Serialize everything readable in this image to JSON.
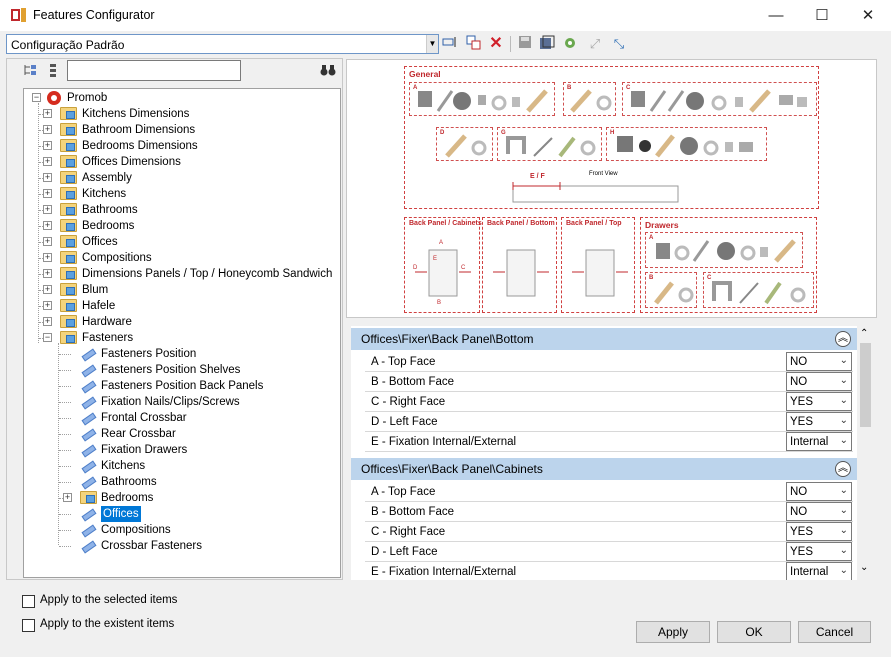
{
  "window": {
    "title": "Features Configurator",
    "minimize": "—",
    "maximize": "☐",
    "close": "✕"
  },
  "config": {
    "selected": "Configuração Padrão"
  },
  "tree": {
    "root": "Promob",
    "items": [
      "Kitchens Dimensions",
      "Bathroom Dimensions",
      "Bedrooms Dimensions",
      "Offices Dimensions",
      "Assembly",
      "Kitchens",
      "Bathrooms",
      "Bedrooms",
      "Offices",
      "Compositions",
      "Dimensions Panels / Top / Honeycomb Sandwich",
      "Blum",
      "Hafele",
      "Hardware",
      "Fasteners"
    ],
    "fasteners_children": [
      "Fasteners Position",
      "Fasteners Position Shelves",
      "Fasteners Position Back Panels",
      "Fixation Nails/Clips/Screws",
      "Frontal Crossbar",
      "Rear Crossbar",
      "Fixation Drawers",
      "Kitchens",
      "Bathrooms",
      "Bedrooms",
      "Offices",
      "Compositions",
      "Crossbar Fasteners"
    ],
    "selected_item": "Offices"
  },
  "checkboxes": {
    "apply_selected": "Apply to the selected items",
    "apply_existent": "Apply to the existent items"
  },
  "preview": {
    "general": "General",
    "front_view": "Front View",
    "dim_label": "E / F",
    "back_panel_cabinets": "Back Panel / Cabinets",
    "back_panel_bottom": "Back Panel / Bottom",
    "back_panel_top": "Back Panel / Top",
    "drawers": "Drawers",
    "group_letters": [
      "A",
      "B",
      "C",
      "D",
      "G",
      "H"
    ],
    "face_letters": [
      "A",
      "B",
      "C",
      "D",
      "E"
    ]
  },
  "sections": [
    {
      "title": "Offices\\Fixer\\Back Panel\\Bottom",
      "rows": [
        {
          "label": "A - Top Face",
          "value": "NO"
        },
        {
          "label": "B - Bottom Face",
          "value": "NO"
        },
        {
          "label": "C - Right Face",
          "value": "YES"
        },
        {
          "label": "D - Left Face",
          "value": "YES"
        },
        {
          "label": "E - Fixation Internal/External",
          "value": "Internal"
        }
      ]
    },
    {
      "title": "Offices\\Fixer\\Back Panel\\Cabinets",
      "rows": [
        {
          "label": "A - Top Face",
          "value": "NO"
        },
        {
          "label": "B - Bottom Face",
          "value": "NO"
        },
        {
          "label": "C - Right Face",
          "value": "YES"
        },
        {
          "label": "D - Left Face",
          "value": "YES"
        },
        {
          "label": "E - Fixation Internal/External",
          "value": "Internal"
        }
      ]
    }
  ],
  "buttons": {
    "apply": "Apply",
    "ok": "OK",
    "cancel": "Cancel"
  },
  "colors": {
    "selection": "#0078d7",
    "section_header": "#bcd4ec",
    "diagram_red": "#c0282d"
  },
  "icons": [
    "app-icon",
    "dropdown-arrow-icon",
    "rename-icon",
    "copy-config-icon",
    "delete-icon",
    "save-icon",
    "save-as-icon",
    "settings-check-icon",
    "export-icon",
    "import-icon",
    "expand-all-icon",
    "collapse-all-icon",
    "binoculars-icon",
    "folder-icon",
    "fastener-icon",
    "collapse-section-icon"
  ]
}
